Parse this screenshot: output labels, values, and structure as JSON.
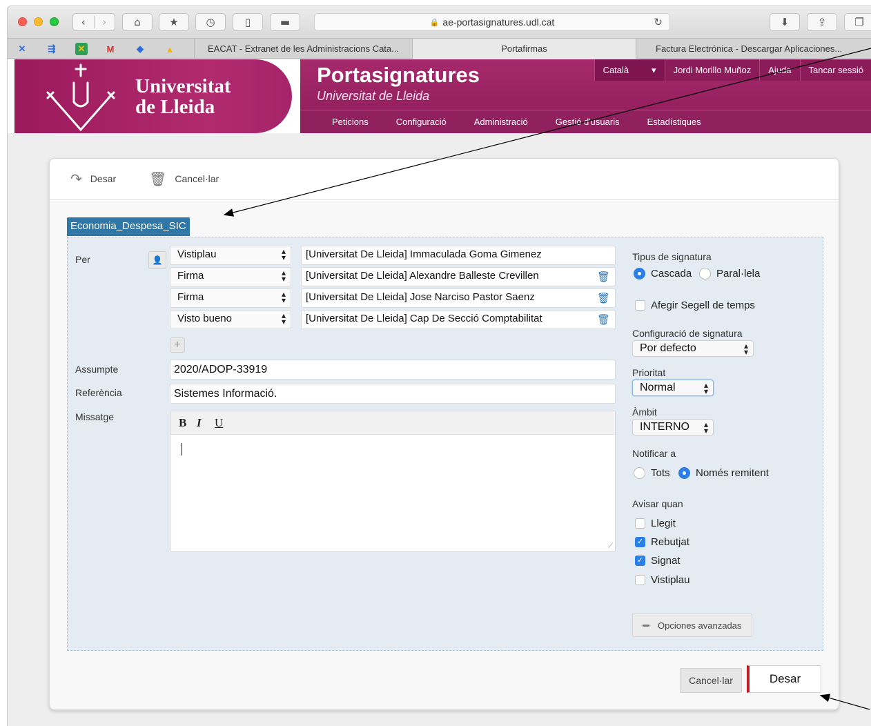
{
  "browser": {
    "url": "ae-portasignatures.udl.cat",
    "tabs": [
      {
        "label": "EACAT - Extranet de les Administracions Cata..."
      },
      {
        "label": "Portafirmas"
      },
      {
        "label": "Factura Electrónica - Descargar Aplicaciones..."
      }
    ]
  },
  "header": {
    "logo_line1": "Universitat",
    "logo_line2": "de Lleida",
    "app_title": "Portasignatures",
    "app_subtitle": "Universitat de Lleida",
    "language": "Català",
    "user": "Jordi Morillo Muñoz",
    "help": "Ajuda",
    "logout": "Tancar sessió",
    "nav": [
      "Peticions",
      "Configuració",
      "Administració",
      "Gestió d'usuaris",
      "Estadístiques"
    ]
  },
  "actions": {
    "save": "Desar",
    "cancel": "Cancel·lar"
  },
  "form": {
    "tag": "Economia_Despesa_SIC",
    "per_label": "Per",
    "signers": [
      {
        "type": "Vistiplau",
        "name": "[Universitat De Lleida] Immaculada Goma Gimenez"
      },
      {
        "type": "Firma",
        "name": "[Universitat De Lleida] Alexandre Balleste Crevillen"
      },
      {
        "type": "Firma",
        "name": "[Universitat De Lleida] Jose Narciso Pastor Saenz"
      },
      {
        "type": "Visto bueno",
        "name": "[Universitat De Lleida] Cap De Secció Comptabilitat"
      }
    ],
    "subject_label": "Assumpte",
    "subject_value": "2020/ADOP-33919",
    "reference_label": "Referència",
    "reference_value": "Sistemes Informació.",
    "message_label": "Missatge",
    "editor_buttons": [
      "B",
      "I",
      "U"
    ]
  },
  "options": {
    "sign_type_label": "Tipus de signatura",
    "sign_type_cascade": "Cascada",
    "sign_type_parallel": "Paral·lela",
    "sign_type_selected": "Cascada",
    "timestamp_label": "Afegir Segell de temps",
    "timestamp_checked": false,
    "config_label": "Configuració de signatura",
    "config_value": "Por defecto",
    "priority_label": "Prioritat",
    "priority_value": "Normal",
    "scope_label": "Àmbit",
    "scope_value": "INTERNO",
    "notify_label": "Notificar a",
    "notify_all": "Tots",
    "notify_sender": "Només remitent",
    "notify_selected": "Només remitent",
    "warn_label": "Avisar quan",
    "warn_items": [
      {
        "label": "Llegit",
        "checked": false
      },
      {
        "label": "Rebutjat",
        "checked": true
      },
      {
        "label": "Signat",
        "checked": true
      },
      {
        "label": "Vistiplau",
        "checked": false
      }
    ],
    "advanced": "Opciones avanzadas"
  },
  "colors": {
    "brand": "#9a1a5c",
    "panel": "#e4ebf2",
    "accent": "#2b7fe6",
    "tag": "#2e77a6",
    "save_border": "#c21d27"
  }
}
